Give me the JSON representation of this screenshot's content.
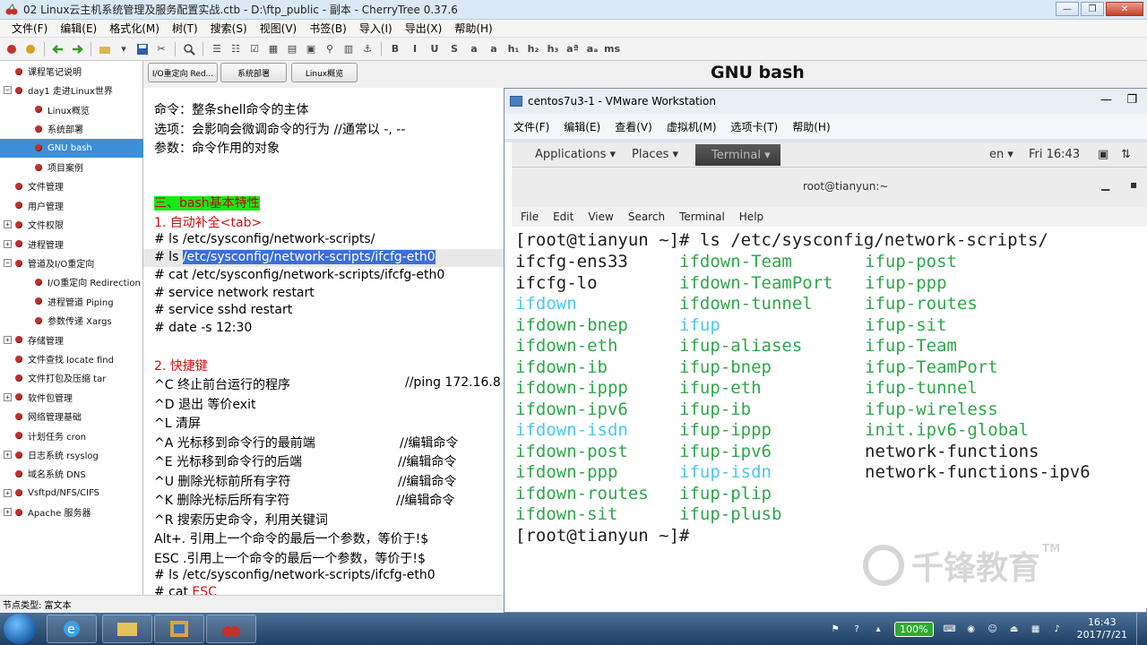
{
  "window": {
    "title": "02 Linux云主机系统管理及服务配置实战.ctb - D:\\ftp_public - 副本 - CherryTree 0.37.6",
    "controls": [
      "—",
      "❐",
      "✕"
    ]
  },
  "menubar": [
    "文件(F)",
    "编辑(E)",
    "格式化(M)",
    "树(T)",
    "搜索(S)",
    "视图(V)",
    "书签(B)",
    "导入(I)",
    "导出(X)",
    "帮助(H)"
  ],
  "toolbar_glyphs": [
    "B",
    "I",
    "U",
    "S",
    "a",
    "a",
    "h₁",
    "h₂",
    "h₃",
    "aª",
    "aₐ",
    "ms"
  ],
  "sidebar": {
    "items": [
      {
        "label": "课程笔记说明",
        "expander": "",
        "indent": 0
      },
      {
        "label": "day1 走进Linux世界",
        "expander": "−",
        "indent": 0
      },
      {
        "label": "Linux概览",
        "expander": "",
        "indent": 1
      },
      {
        "label": "系统部署",
        "expander": "",
        "indent": 1
      },
      {
        "label": "GNU bash",
        "expander": "",
        "indent": 1,
        "selected": true
      },
      {
        "label": "项目案例",
        "expander": "",
        "indent": 1
      },
      {
        "label": "文件管理",
        "expander": "",
        "indent": 0
      },
      {
        "label": "用户管理",
        "expander": "",
        "indent": 0
      },
      {
        "label": "文件权限",
        "expander": "+",
        "indent": 0
      },
      {
        "label": "进程管理",
        "expander": "+",
        "indent": 0
      },
      {
        "label": "管道及I/O重定向",
        "expander": "−",
        "indent": 0
      },
      {
        "label": "I/O重定向 Redirection",
        "expander": "",
        "indent": 1
      },
      {
        "label": "进程管道 Piping",
        "expander": "",
        "indent": 1
      },
      {
        "label": "参数传递 Xargs",
        "expander": "",
        "indent": 1
      },
      {
        "label": "存储管理",
        "expander": "+",
        "indent": 0
      },
      {
        "label": "文件查找 locate find",
        "expander": "",
        "indent": 0
      },
      {
        "label": "文件打包及压缩 tar",
        "expander": "",
        "indent": 0
      },
      {
        "label": "软件包管理",
        "expander": "+",
        "indent": 0
      },
      {
        "label": "网络管理基础",
        "expander": "",
        "indent": 0
      },
      {
        "label": "计划任务 cron",
        "expander": "",
        "indent": 0
      },
      {
        "label": "日志系统 rsyslog",
        "expander": "+",
        "indent": 0
      },
      {
        "label": "域名系统 DNS",
        "expander": "",
        "indent": 0
      },
      {
        "label": "Vsftpd/NFS/CIFS",
        "expander": "+",
        "indent": 0
      },
      {
        "label": "Apache 服务器",
        "expander": "+",
        "indent": 0
      }
    ]
  },
  "status": "节点类型: 富文本",
  "header": {
    "tabs": [
      "I/O重定向 Red...",
      "系统部署",
      "Linux概览"
    ],
    "page_title": "GNU bash"
  },
  "editor": {
    "lines": [
      "命令：整条shell命令的主体",
      "选项：会影响会微调命令的行为    //通常以 -, --",
      "参数：命令作用的对象",
      "",
      "",
      "三、bash基本特性",
      "1. 自动补全<tab>",
      "# ls /etc/sysconfig/network-scripts/",
      "# ls ",
      "/etc/sysconfig/network-scripts/ifcfg-eth0",
      "# cat /etc/sysconfig/network-scripts/ifcfg-eth0",
      "# service network restart",
      "# service sshd restart",
      "# date -s 12:30",
      "",
      "2. 快捷键",
      "^C   终止前台运行的程序",
      "//ping 172.16.8",
      "^D   退出 等价exit",
      "^L    清屏",
      "^A   光标移到命令行的最前端",
      "//编辑命令",
      "^E   光标移到命令行的后端",
      "//编辑命令",
      "^U   删除光标前所有字符",
      "//编辑命令",
      "^K   删除光标后所有字符",
      "//编辑命令",
      "^R   搜索历史命令，利用关键词",
      "Alt+. 引用上一个命令的最后一个参数，等价于!$",
      "ESC .引用上一个命令的最后一个参数，等价于!$",
      "# ls /etc/sysconfig/network-scripts/ifcfg-eth0",
      "# cat ",
      "ESC"
    ]
  },
  "vmware": {
    "title": "centos7u3-1 - VMware Workstation",
    "menu": [
      "文件(F)",
      "编辑(E)",
      "查看(V)",
      "虚拟机(M)",
      "选项卡(T)",
      "帮助(H)"
    ],
    "gnome": {
      "applications": "Applications ▾",
      "places": "Places ▾",
      "terminal_tab": "Terminal ▾",
      "lang": "en ▾",
      "clock": "Fri 16:43"
    },
    "terminal": {
      "title": "root@tianyun:~",
      "menu": [
        "File",
        "Edit",
        "View",
        "Search",
        "Terminal",
        "Help"
      ],
      "prompt1": "[root@tianyun ~]# ls /etc/sysconfig/network-scripts/",
      "prompt2": "[root@tianyun ~]#",
      "files": [
        [
          "ifcfg-ens33",
          "ifdown-Team",
          "ifup-post"
        ],
        [
          "ifcfg-lo",
          "ifdown-TeamPort",
          "ifup-ppp"
        ],
        [
          "ifdown",
          "ifdown-tunnel",
          "ifup-routes"
        ],
        [
          "ifdown-bnep",
          "ifup",
          "ifup-sit"
        ],
        [
          "ifdown-eth",
          "ifup-aliases",
          "ifup-Team"
        ],
        [
          "ifdown-ib",
          "ifup-bnep",
          "ifup-TeamPort"
        ],
        [
          "ifdown-ippp",
          "ifup-eth",
          "ifup-tunnel"
        ],
        [
          "ifdown-ipv6",
          "ifup-ib",
          "ifup-wireless"
        ],
        [
          "ifdown-isdn",
          "ifup-ippp",
          "init.ipv6-global"
        ],
        [
          "ifdown-post",
          "ifup-ipv6",
          "network-functions"
        ],
        [
          "ifdown-ppp",
          "ifup-isdn",
          "network-functions-ipv6"
        ],
        [
          "ifdown-routes",
          "ifup-plip",
          ""
        ],
        [
          "ifdown-sit",
          "ifup-plusb",
          ""
        ]
      ],
      "colors": [
        [
          "plain",
          "green",
          "green"
        ],
        [
          "plain",
          "green",
          "green"
        ],
        [
          "cyan",
          "green",
          "green"
        ],
        [
          "green",
          "cyan",
          "green"
        ],
        [
          "green",
          "green",
          "green"
        ],
        [
          "green",
          "green",
          "green"
        ],
        [
          "green",
          "green",
          "green"
        ],
        [
          "green",
          "green",
          "green"
        ],
        [
          "cyan",
          "green",
          "green"
        ],
        [
          "green",
          "green",
          "plain"
        ],
        [
          "green",
          "cyan",
          "plain"
        ],
        [
          "green",
          "green",
          ""
        ],
        [
          "green",
          "green",
          ""
        ]
      ]
    }
  },
  "watermark": {
    "text": "千锋教育",
    "tm": "TM"
  },
  "taskbar": {
    "zoom": "100%",
    "time": "16:43",
    "date": "2017/7/21"
  },
  "colors": {
    "selection": "#3a6fd8",
    "heading_bg": "#18e818",
    "heading_red": "#d01010",
    "term_green": "#2da84a",
    "term_cyan": "#49c8ef"
  }
}
